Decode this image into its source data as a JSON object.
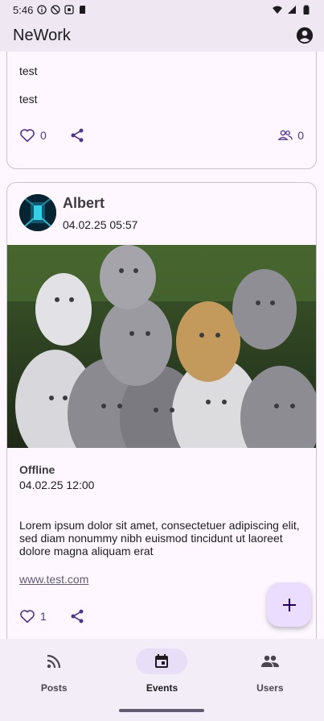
{
  "status_bar": {
    "time": "5:46",
    "icons": [
      "info-circle-icon",
      "no-disturb-icon",
      "vpn-key-icon",
      "sd-card-icon",
      "wifi-icon",
      "signal-icon",
      "battery-icon"
    ]
  },
  "app_bar": {
    "title": "NeWork",
    "account_icon": "account-circle-icon"
  },
  "posts": [
    {
      "lines": [
        "test",
        "test"
      ],
      "likes": "0",
      "participants": "0"
    },
    {
      "author": "Albert",
      "published": "04.02.25 05:57",
      "image_alt": "kittens-photo",
      "event_type": "Offline",
      "event_datetime": "04.02.25 12:00",
      "content": "Lorem ipsum dolor sit amet, consectetuer adipiscing elit, sed diam nonummy nibh euismod tincidunt ut laoreet dolore magna aliquam erat",
      "link": "www.test.com",
      "likes": "1"
    }
  ],
  "fab": {
    "icon": "plus-icon"
  },
  "bottom_nav": {
    "items": [
      {
        "label": "Posts",
        "icon": "rss-feed-icon",
        "active": false
      },
      {
        "label": "Events",
        "icon": "calendar-icon",
        "active": true
      },
      {
        "label": "Users",
        "icon": "people-icon",
        "active": false
      }
    ]
  },
  "colors": {
    "background": "#fef7ff",
    "app_bar": "#efe8f3",
    "accent": "#4f378b",
    "fab": "#eaddff",
    "nav_active_pill": "#e8def8"
  }
}
